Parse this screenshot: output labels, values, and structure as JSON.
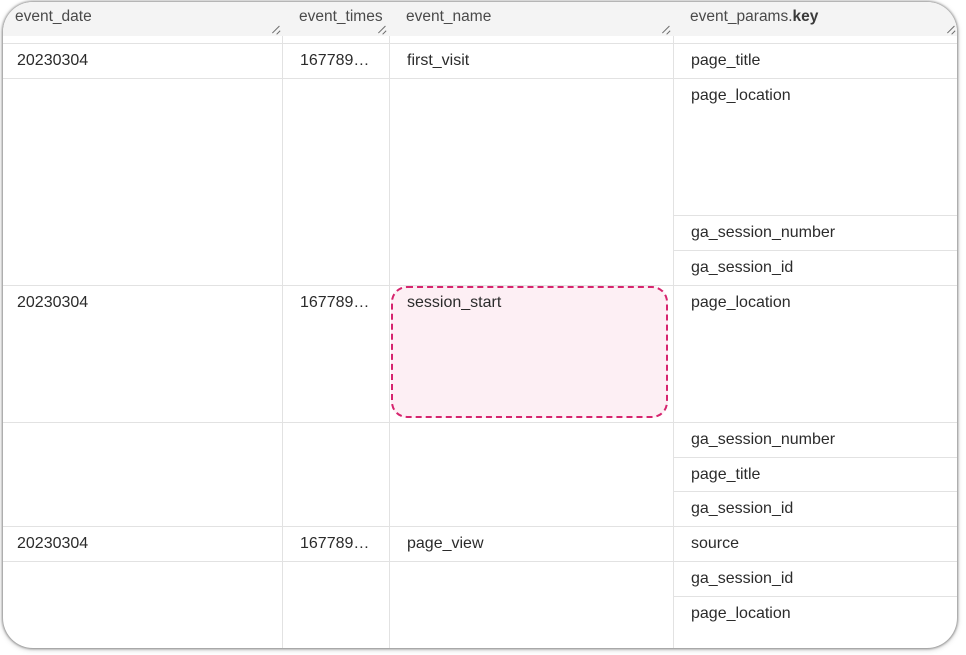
{
  "columns": [
    {
      "label": "event_date"
    },
    {
      "label": "event_times"
    },
    {
      "label": "event_name"
    },
    {
      "prefix": "event_params.",
      "suffix": "key"
    }
  ],
  "rows": [
    {
      "event_date": "20230304",
      "event_timestamp": "167789…",
      "event_name": "first_visit",
      "param_keys": [
        "page_title",
        "page_location",
        "ga_session_number",
        "ga_session_id"
      ]
    },
    {
      "event_date": "20230304",
      "event_timestamp": "167789…",
      "event_name": "session_start",
      "highlighted": true,
      "param_keys": [
        "page_location",
        "ga_session_number",
        "page_title",
        "ga_session_id"
      ]
    },
    {
      "event_date": "20230304",
      "event_timestamp": "167789…",
      "event_name": "page_view",
      "param_keys": [
        "source",
        "ga_session_id",
        "page_location"
      ]
    }
  ],
  "colors": {
    "highlight_border": "#d6246e",
    "header_bg": "#f4f4f4",
    "grid_line": "#e2e2e2"
  }
}
